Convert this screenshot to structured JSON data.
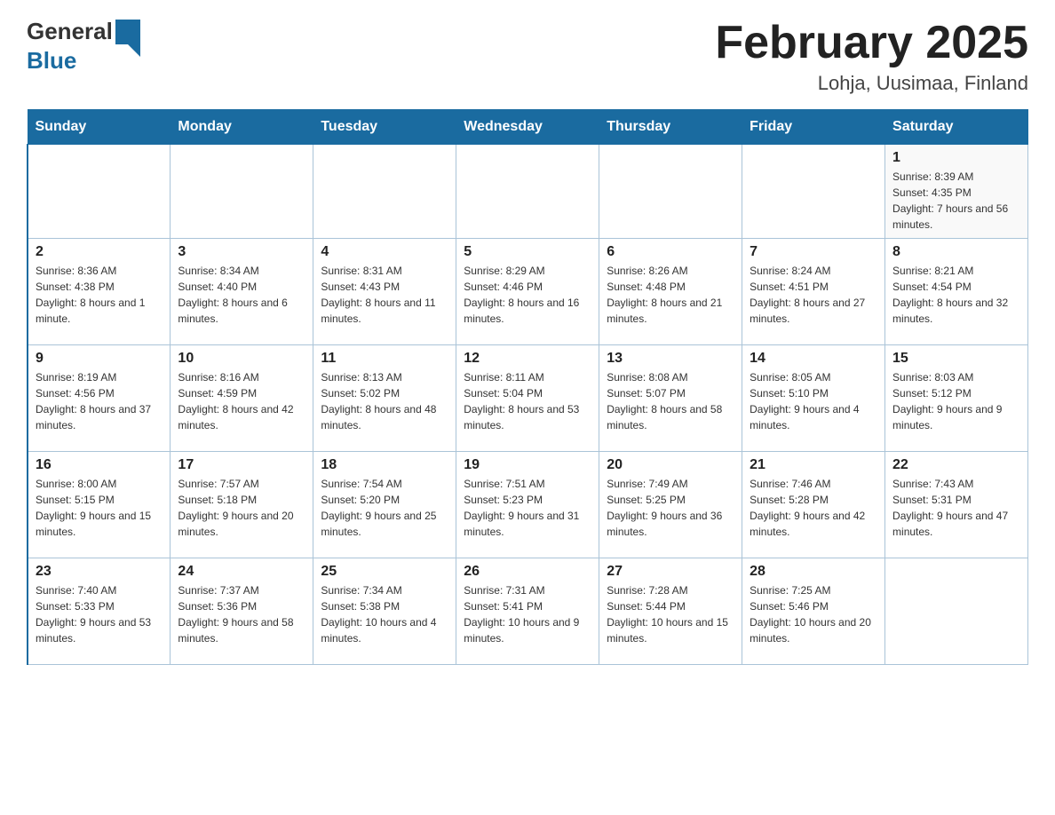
{
  "header": {
    "logo": {
      "general_text": "General",
      "blue_text": "Blue"
    },
    "title": "February 2025",
    "location": "Lohja, Uusimaa, Finland"
  },
  "days_of_week": [
    "Sunday",
    "Monday",
    "Tuesday",
    "Wednesday",
    "Thursday",
    "Friday",
    "Saturday"
  ],
  "weeks": [
    [
      {
        "day": "",
        "sunrise": "",
        "sunset": "",
        "daylight": ""
      },
      {
        "day": "",
        "sunrise": "",
        "sunset": "",
        "daylight": ""
      },
      {
        "day": "",
        "sunrise": "",
        "sunset": "",
        "daylight": ""
      },
      {
        "day": "",
        "sunrise": "",
        "sunset": "",
        "daylight": ""
      },
      {
        "day": "",
        "sunrise": "",
        "sunset": "",
        "daylight": ""
      },
      {
        "day": "",
        "sunrise": "",
        "sunset": "",
        "daylight": ""
      },
      {
        "day": "1",
        "sunrise": "Sunrise: 8:39 AM",
        "sunset": "Sunset: 4:35 PM",
        "daylight": "Daylight: 7 hours and 56 minutes."
      }
    ],
    [
      {
        "day": "2",
        "sunrise": "Sunrise: 8:36 AM",
        "sunset": "Sunset: 4:38 PM",
        "daylight": "Daylight: 8 hours and 1 minute."
      },
      {
        "day": "3",
        "sunrise": "Sunrise: 8:34 AM",
        "sunset": "Sunset: 4:40 PM",
        "daylight": "Daylight: 8 hours and 6 minutes."
      },
      {
        "day": "4",
        "sunrise": "Sunrise: 8:31 AM",
        "sunset": "Sunset: 4:43 PM",
        "daylight": "Daylight: 8 hours and 11 minutes."
      },
      {
        "day": "5",
        "sunrise": "Sunrise: 8:29 AM",
        "sunset": "Sunset: 4:46 PM",
        "daylight": "Daylight: 8 hours and 16 minutes."
      },
      {
        "day": "6",
        "sunrise": "Sunrise: 8:26 AM",
        "sunset": "Sunset: 4:48 PM",
        "daylight": "Daylight: 8 hours and 21 minutes."
      },
      {
        "day": "7",
        "sunrise": "Sunrise: 8:24 AM",
        "sunset": "Sunset: 4:51 PM",
        "daylight": "Daylight: 8 hours and 27 minutes."
      },
      {
        "day": "8",
        "sunrise": "Sunrise: 8:21 AM",
        "sunset": "Sunset: 4:54 PM",
        "daylight": "Daylight: 8 hours and 32 minutes."
      }
    ],
    [
      {
        "day": "9",
        "sunrise": "Sunrise: 8:19 AM",
        "sunset": "Sunset: 4:56 PM",
        "daylight": "Daylight: 8 hours and 37 minutes."
      },
      {
        "day": "10",
        "sunrise": "Sunrise: 8:16 AM",
        "sunset": "Sunset: 4:59 PM",
        "daylight": "Daylight: 8 hours and 42 minutes."
      },
      {
        "day": "11",
        "sunrise": "Sunrise: 8:13 AM",
        "sunset": "Sunset: 5:02 PM",
        "daylight": "Daylight: 8 hours and 48 minutes."
      },
      {
        "day": "12",
        "sunrise": "Sunrise: 8:11 AM",
        "sunset": "Sunset: 5:04 PM",
        "daylight": "Daylight: 8 hours and 53 minutes."
      },
      {
        "day": "13",
        "sunrise": "Sunrise: 8:08 AM",
        "sunset": "Sunset: 5:07 PM",
        "daylight": "Daylight: 8 hours and 58 minutes."
      },
      {
        "day": "14",
        "sunrise": "Sunrise: 8:05 AM",
        "sunset": "Sunset: 5:10 PM",
        "daylight": "Daylight: 9 hours and 4 minutes."
      },
      {
        "day": "15",
        "sunrise": "Sunrise: 8:03 AM",
        "sunset": "Sunset: 5:12 PM",
        "daylight": "Daylight: 9 hours and 9 minutes."
      }
    ],
    [
      {
        "day": "16",
        "sunrise": "Sunrise: 8:00 AM",
        "sunset": "Sunset: 5:15 PM",
        "daylight": "Daylight: 9 hours and 15 minutes."
      },
      {
        "day": "17",
        "sunrise": "Sunrise: 7:57 AM",
        "sunset": "Sunset: 5:18 PM",
        "daylight": "Daylight: 9 hours and 20 minutes."
      },
      {
        "day": "18",
        "sunrise": "Sunrise: 7:54 AM",
        "sunset": "Sunset: 5:20 PM",
        "daylight": "Daylight: 9 hours and 25 minutes."
      },
      {
        "day": "19",
        "sunrise": "Sunrise: 7:51 AM",
        "sunset": "Sunset: 5:23 PM",
        "daylight": "Daylight: 9 hours and 31 minutes."
      },
      {
        "day": "20",
        "sunrise": "Sunrise: 7:49 AM",
        "sunset": "Sunset: 5:25 PM",
        "daylight": "Daylight: 9 hours and 36 minutes."
      },
      {
        "day": "21",
        "sunrise": "Sunrise: 7:46 AM",
        "sunset": "Sunset: 5:28 PM",
        "daylight": "Daylight: 9 hours and 42 minutes."
      },
      {
        "day": "22",
        "sunrise": "Sunrise: 7:43 AM",
        "sunset": "Sunset: 5:31 PM",
        "daylight": "Daylight: 9 hours and 47 minutes."
      }
    ],
    [
      {
        "day": "23",
        "sunrise": "Sunrise: 7:40 AM",
        "sunset": "Sunset: 5:33 PM",
        "daylight": "Daylight: 9 hours and 53 minutes."
      },
      {
        "day": "24",
        "sunrise": "Sunrise: 7:37 AM",
        "sunset": "Sunset: 5:36 PM",
        "daylight": "Daylight: 9 hours and 58 minutes."
      },
      {
        "day": "25",
        "sunrise": "Sunrise: 7:34 AM",
        "sunset": "Sunset: 5:38 PM",
        "daylight": "Daylight: 10 hours and 4 minutes."
      },
      {
        "day": "26",
        "sunrise": "Sunrise: 7:31 AM",
        "sunset": "Sunset: 5:41 PM",
        "daylight": "Daylight: 10 hours and 9 minutes."
      },
      {
        "day": "27",
        "sunrise": "Sunrise: 7:28 AM",
        "sunset": "Sunset: 5:44 PM",
        "daylight": "Daylight: 10 hours and 15 minutes."
      },
      {
        "day": "28",
        "sunrise": "Sunrise: 7:25 AM",
        "sunset": "Sunset: 5:46 PM",
        "daylight": "Daylight: 10 hours and 20 minutes."
      },
      {
        "day": "",
        "sunrise": "",
        "sunset": "",
        "daylight": ""
      }
    ]
  ]
}
